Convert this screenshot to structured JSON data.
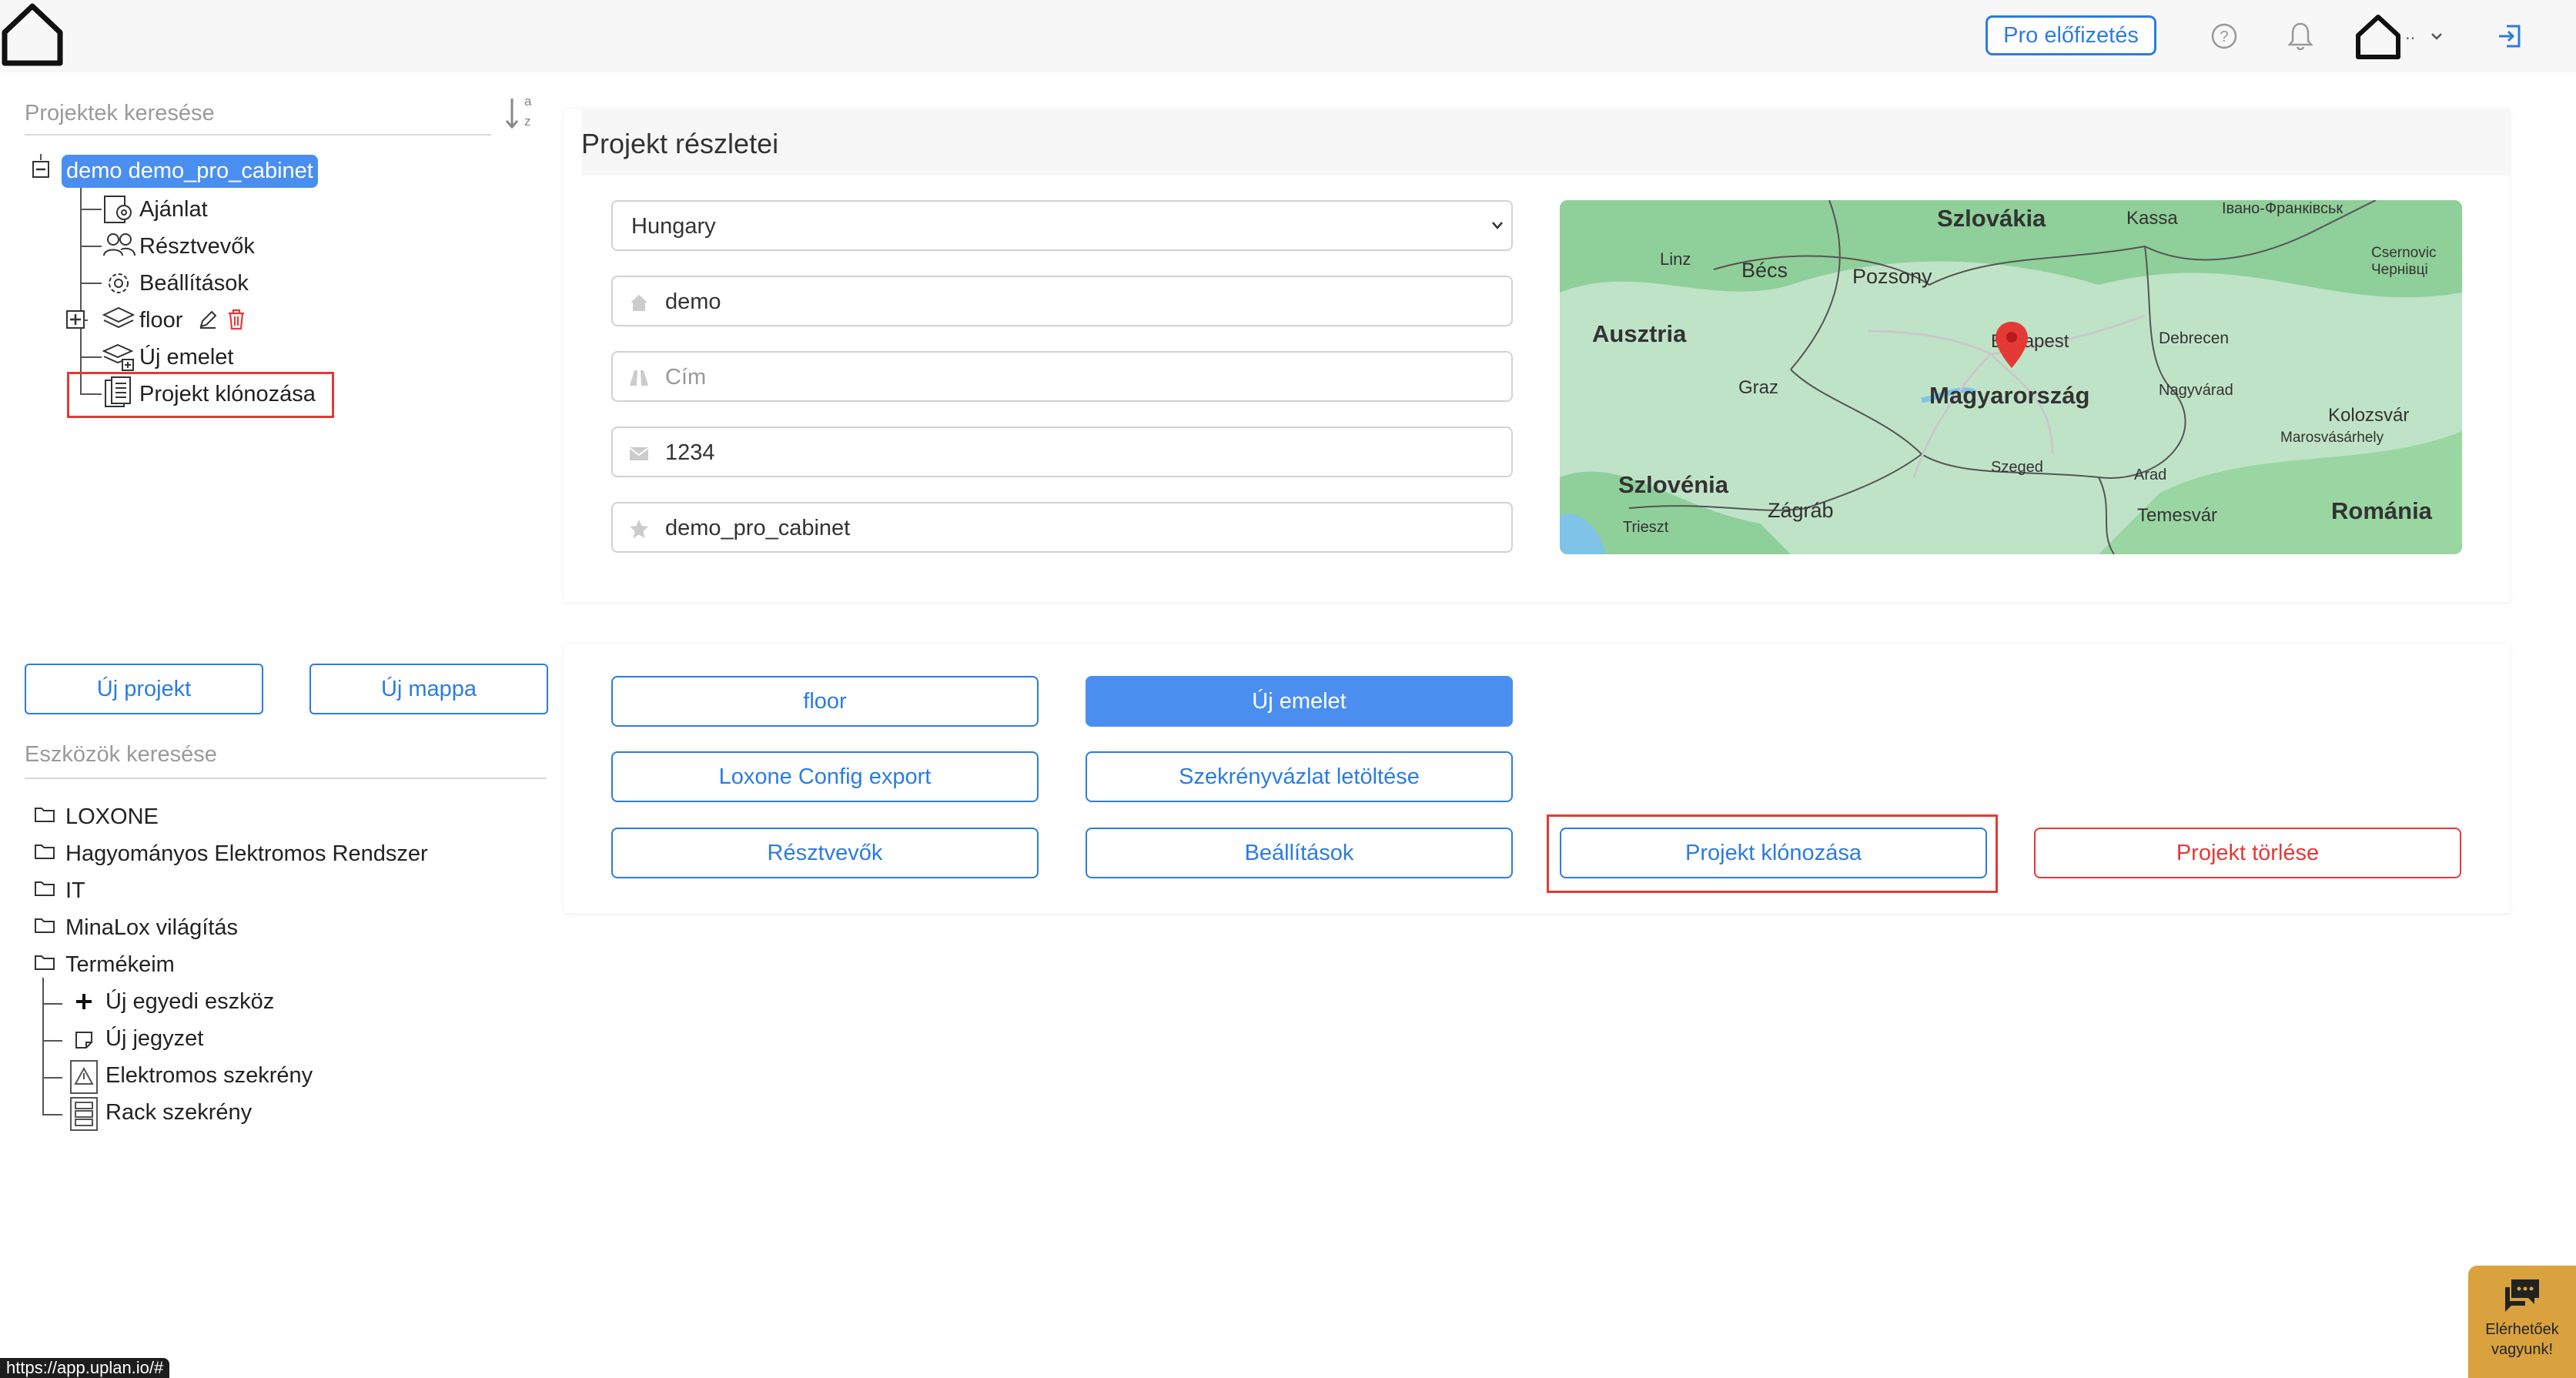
{
  "header": {
    "pro_button": "Pro előfizetés",
    "user_menu_label": ".."
  },
  "projects_search": {
    "placeholder": "Projektek keresése",
    "sort_a": "a",
    "sort_z": "z"
  },
  "project_tree": {
    "root": "demo demo_pro_cabinet",
    "items": [
      "Ajánlat",
      "Résztvevők",
      "Beállítások",
      "floor",
      "Új emelet",
      "Projekt klónozása"
    ]
  },
  "left_buttons": {
    "new_project": "Új projekt",
    "new_folder": "Új mappa"
  },
  "tools_search": {
    "placeholder": "Eszközök keresése"
  },
  "tools_tree": {
    "folders": [
      "LOXONE",
      "Hagyományos Elektromos Rendszer",
      "IT",
      "MinaLox világítás",
      "Termékeim"
    ],
    "my_products": [
      "Új egyedi eszköz",
      "Új jegyzet",
      "Elektromos szekrény",
      "Rack szekrény"
    ]
  },
  "project_details": {
    "title": "Projekt részletei",
    "country": "Hungary",
    "name": "demo",
    "address_placeholder": "Cím",
    "zip": "1234",
    "project_id": "demo_pro_cabinet"
  },
  "map": {
    "labels": [
      "Szlovákia",
      "Kassa",
      "Івано-Франківськ",
      "Linz",
      "Bécs",
      "Pozsony",
      "Csernovic",
      "Чернівці",
      "Ausztria",
      "Budapest",
      "Debrecen",
      "Graz",
      "Magyarország",
      "Nagyvárad",
      "Kolozsvár",
      "Marosvásárhely",
      "Szeged",
      "Arad",
      "Szlovénia",
      "Zágráb",
      "Trieszt",
      "Temesvár",
      "Románia"
    ]
  },
  "actions": {
    "floor": "floor",
    "new_floor": "Új emelet",
    "loxone_export": "Loxone Config export",
    "cabinet_download": "Szekrényvázlat letöltése",
    "participants": "Résztvevők",
    "settings": "Beállítások",
    "clone": "Projekt klónozása",
    "delete": "Projekt törlése"
  },
  "chat_widget": {
    "line1": "Elérhetőek",
    "line2": "vagyunk!"
  },
  "status_bar": {
    "url": "https://app.uplan.io/#"
  },
  "colors": {
    "accent": "#2c7ce0",
    "accent_fill": "#4a8ff0",
    "danger": "#e53935",
    "chat": "#d9a23e"
  }
}
